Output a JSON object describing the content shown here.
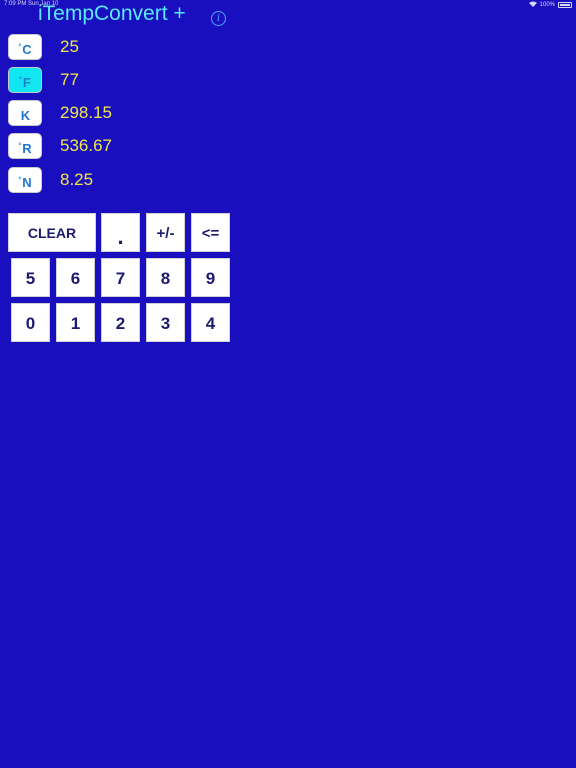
{
  "status_bar": {
    "time": "7:09 PM",
    "date": "Sun Jan 10",
    "battery_percent": "100%"
  },
  "app": {
    "title": "iTempConvert +",
    "info_icon": "info-icon"
  },
  "units": [
    {
      "symbol": "°C",
      "deg": "°",
      "letter": "C",
      "value": "25",
      "selected": false
    },
    {
      "symbol": "°F",
      "deg": "°",
      "letter": "F",
      "value": "77",
      "selected": true
    },
    {
      "symbol": "K",
      "deg": "",
      "letter": "K",
      "value": "298.15",
      "selected": false
    },
    {
      "symbol": "°R",
      "deg": "°",
      "letter": "R",
      "value": "536.67",
      "selected": false
    },
    {
      "symbol": "°N",
      "deg": "°",
      "letter": "N",
      "value": "8.25",
      "selected": false
    }
  ],
  "keypad": {
    "clear": "CLEAR",
    "decimal": ".",
    "sign": "+/-",
    "backspace": "<=",
    "row2": [
      "5",
      "6",
      "7",
      "8",
      "9"
    ],
    "row3": [
      "0",
      "1",
      "2",
      "3",
      "4"
    ]
  },
  "colors": {
    "background": "#1a0fbf",
    "title": "#5ae8ff",
    "value_text": "#f2e64a",
    "selected_unit": "#12e6f2",
    "key_text": "#1d1a6e"
  }
}
